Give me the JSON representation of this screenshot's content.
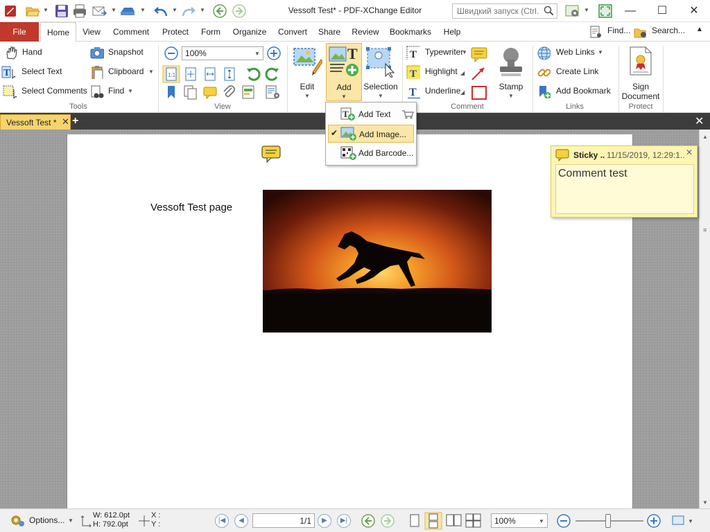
{
  "window": {
    "title": "Vessoft Test* - PDF-XChange Editor",
    "quick_launch_placeholder": "Швидкий запуск (Ctrl...",
    "minimize": "—",
    "maximize": "☐",
    "close": "✕"
  },
  "menu": {
    "tabs": [
      "File",
      "Home",
      "View",
      "Comment",
      "Protect",
      "Form",
      "Organize",
      "Convert",
      "Share",
      "Review",
      "Bookmarks",
      "Help"
    ],
    "find_label": "Find...",
    "search_label": "Search..."
  },
  "ribbon": {
    "tools": {
      "label": "Tools",
      "hand": "Hand",
      "select_text": "Select Text",
      "select_comments": "Select Comments",
      "snapshot": "Snapshot",
      "clipboard": "Clipboard",
      "find": "Find"
    },
    "view": {
      "label": "View",
      "zoom_value": "100%"
    },
    "objects": {
      "edit": "Edit",
      "add": "Add",
      "selection": "Selection"
    },
    "comment": {
      "label": "Comment",
      "typewriter": "Typewriter",
      "highlight": "Highlight",
      "underline": "Underline",
      "stamp": "Stamp"
    },
    "links": {
      "label": "Links",
      "web_links": "Web Links",
      "create_link": "Create Link",
      "add_bookmark": "Add Bookmark"
    },
    "protect": {
      "label": "Protect",
      "sign_line1": "Sign",
      "sign_line2": "Document"
    }
  },
  "add_menu": {
    "items": [
      "Add Text",
      "Add Image...",
      "Add Barcode..."
    ]
  },
  "document": {
    "tab_title": "Vessoft Test *",
    "page_text": "Vessoft Test page"
  },
  "sticky_note": {
    "author": "Sticky ..",
    "timestamp": "11/15/2019, 12:29:1..",
    "text": "Comment test"
  },
  "status": {
    "options": "Options...",
    "width": "W: 612.0pt",
    "height": "H: 792.0pt",
    "x": "X :",
    "y": "Y :",
    "page_indicator": "1/1",
    "zoom": "100%"
  },
  "colors": {
    "file_tab": "#c0392b",
    "doc_tab": "#f6d46d",
    "sticky": "#fcf5b4",
    "menu_highlight": "#fbe6a8"
  }
}
